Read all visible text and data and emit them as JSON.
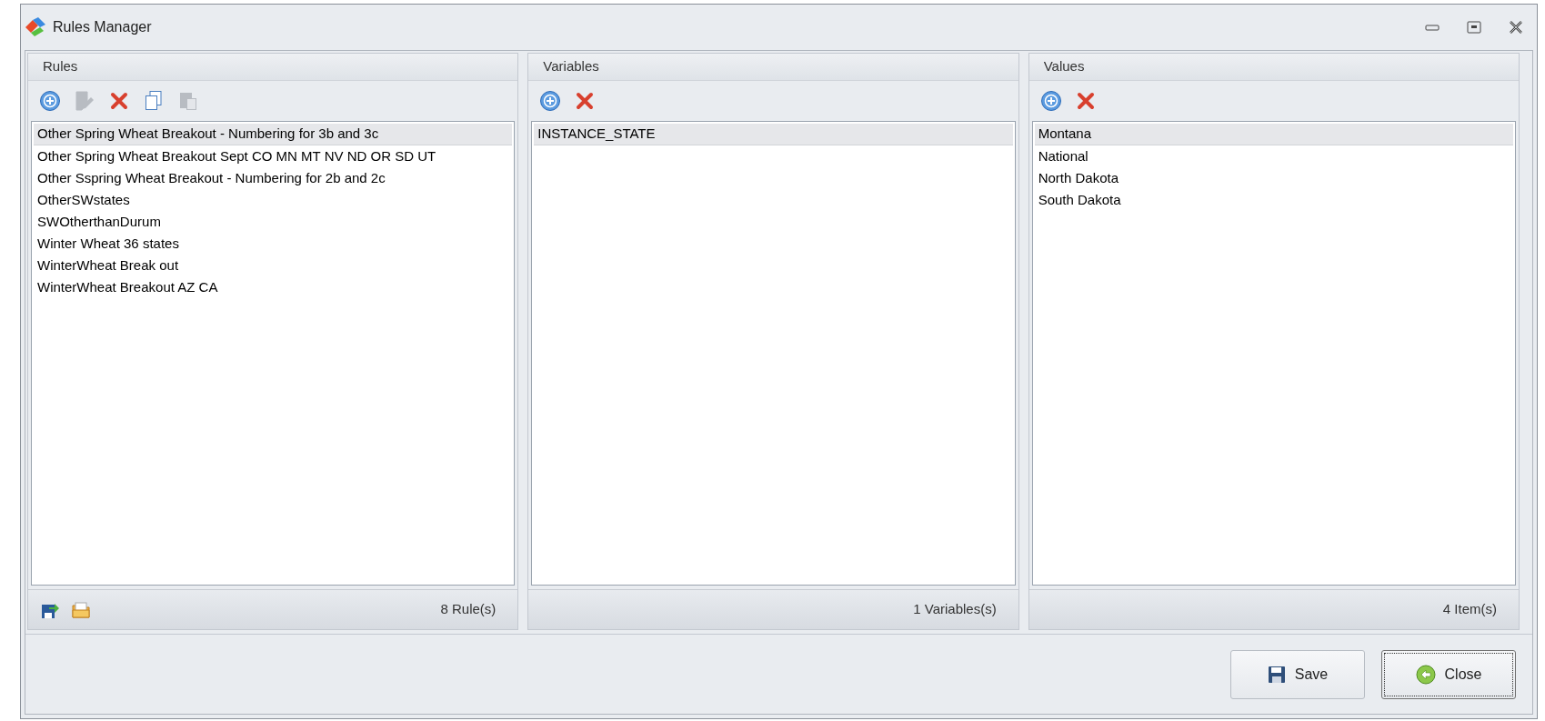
{
  "window": {
    "title": "Rules Manager"
  },
  "panels": [
    {
      "title": "Rules",
      "toolbar": [
        {
          "kind": "add",
          "disabled": false
        },
        {
          "kind": "edit",
          "disabled": true
        },
        {
          "kind": "delete",
          "disabled": false
        },
        {
          "kind": "copy",
          "disabled": false
        },
        {
          "kind": "paste",
          "disabled": true
        }
      ],
      "items": [
        {
          "label": "Other Spring Wheat Breakout - Numbering for 3b and 3c",
          "selected": true
        },
        {
          "label": "Other Spring Wheat Breakout Sept CO MN MT NV ND OR SD UT",
          "selected": false
        },
        {
          "label": "Other Sspring Wheat Breakout - Numbering for 2b and 2c",
          "selected": false
        },
        {
          "label": "OtherSWstates",
          "selected": false
        },
        {
          "label": "SWOtherthanDurum",
          "selected": false
        },
        {
          "label": "Winter Wheat 36 states",
          "selected": false
        },
        {
          "label": "WinterWheat Break out",
          "selected": false
        },
        {
          "label": "WinterWheat Breakout AZ CA",
          "selected": false
        }
      ],
      "footer_tools": [
        {
          "kind": "export"
        },
        {
          "kind": "open"
        }
      ],
      "count": "8 Rule(s)"
    },
    {
      "title": "Variables",
      "toolbar": [
        {
          "kind": "add",
          "disabled": false
        },
        {
          "kind": "delete",
          "disabled": false
        }
      ],
      "items": [
        {
          "label": "INSTANCE_STATE",
          "selected": true
        }
      ],
      "count": "1 Variables(s)"
    },
    {
      "title": "Values",
      "toolbar": [
        {
          "kind": "add",
          "disabled": false
        },
        {
          "kind": "delete",
          "disabled": false
        }
      ],
      "items": [
        {
          "label": "Montana",
          "selected": true
        },
        {
          "label": "National",
          "selected": false
        },
        {
          "label": "North Dakota",
          "selected": false
        },
        {
          "label": "South Dakota",
          "selected": false
        }
      ],
      "count": "4 Item(s)"
    }
  ],
  "buttons": [
    {
      "kind": "save",
      "label": "Save",
      "focused": false
    },
    {
      "kind": "close",
      "label": "Close",
      "focused": true
    }
  ]
}
